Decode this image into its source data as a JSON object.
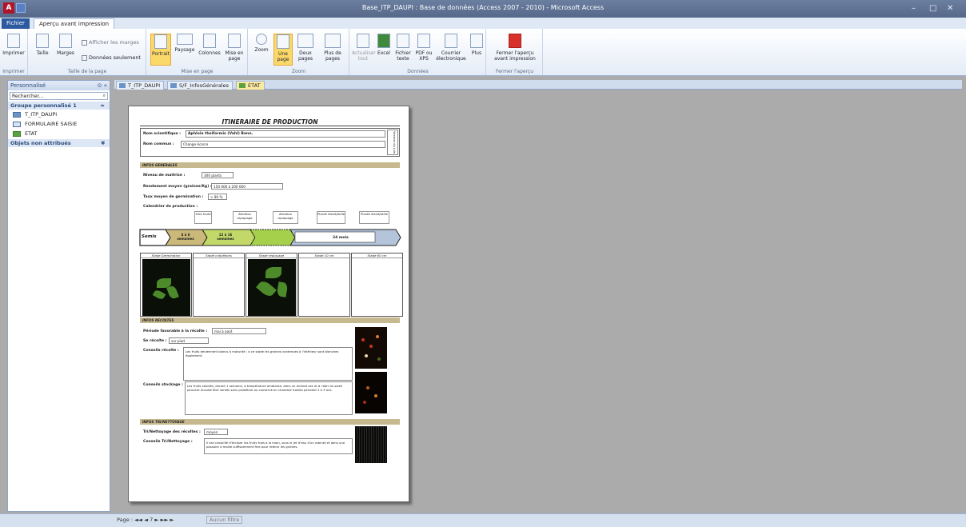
{
  "window": {
    "title": "Base_ITP_DAUPI : Base de données (Access 2007 - 2010) - Microsoft Access",
    "icon": "A",
    "controls": [
      "–",
      "□",
      "✕"
    ]
  },
  "tabs": {
    "file": "Fichier",
    "preview": "Aperçu avant impression"
  },
  "ribbon": {
    "print": {
      "print": "Imprimer",
      "group": "Imprimer"
    },
    "pagesize": {
      "size": "Taille",
      "margins": "Marges",
      "show_margins": "Afficher les marges",
      "data_only": "Données seulement",
      "group": "Taille de la page"
    },
    "layout": {
      "portrait": "Portrait",
      "landscape": "Paysage",
      "columns": "Colonnes",
      "setup": "Mise en page",
      "group": "Mise en page"
    },
    "zoom": {
      "zoom": "Zoom",
      "one": "Une page",
      "two": "Deux pages",
      "more": "Plus de pages",
      "group": "Zoom"
    },
    "data": {
      "refresh": "Actualiser tout",
      "excel": "Excel",
      "text": "Fichier texte",
      "pdf": "PDF ou XPS",
      "email": "Courrier électronique",
      "more": "Plus",
      "group": "Données"
    },
    "close": {
      "close": "Fermer l'aperçu avant impression",
      "group": "Fermer l'aperçu"
    }
  },
  "nav": {
    "header": "Personnalisé",
    "search_placeholder": "Rechercher...",
    "group1": "Groupe personnalisé 1",
    "items": [
      "T_ITP_DAUPI",
      "FORMULAIRE SAISIE",
      "ETAT"
    ],
    "group2": "Objets non attribués"
  },
  "doctabs": [
    "T_ITP_DAUPI",
    "S/F_InfosGénérales",
    "ETAT"
  ],
  "report": {
    "title": "ITINERAIRE DE PRODUCTION",
    "sci_label": "Nom scientifique :",
    "sci_value": "Aphloia theiformis (Vahl) Benn.",
    "common_label": "Nom commun :",
    "common_value": "Change écorce",
    "version": "Version du juin 2012",
    "sec_general": "INFOS GENERALES",
    "level_label": "Niveau de maîtrise :",
    "level_value": "300 plants",
    "yield_label": "Rendement moyen (graines/Kg) :",
    "yield_value": "150 000 à 200 000",
    "germ_label": "Taux moyen de germination :",
    "germ_value": "> 80 %",
    "cal_label": "Calendrier de production :",
    "callouts": [
      "1ère fonte",
      "Aération repiquage",
      "Aération repiquage",
      "Planté élevé/taille",
      "Planté élevé/taille"
    ],
    "arrows": [
      "Semis",
      "4 à 6 semaines",
      "12 à 16 semaines",
      "24 mois"
    ],
    "stages": [
      "Stade Germination",
      "Stade cotylédons",
      "Stade repiquage",
      "Stade 10 cm",
      "Stade 60 cm"
    ],
    "sec_harvest": "INFOS RECOLTES",
    "period_label": "Période favorable à la récolte :",
    "period_value": "mai à août",
    "collect_label": "Se récolte :",
    "collect_value": "sur pied",
    "advice_label": "Conseils récolte :",
    "advice_value": "Les fruits deviennent blancs à maturité ; à ce stade les graines contenues à l'intérieur sont blanches également.",
    "storage_label": "Conseils stockage :",
    "storage_value": "Les fruits stockés, durant 1 semaine, à température ambiante, dans un endroit sec et à l'abri du soleil peuvent ensuite être semés sans problème ou conservé en chambre froides pendant 2 à 3 ans.",
    "sec_sort": "INFOS TRI/NETTOYAGE",
    "sort_label": "Tri/Nettoyage des récoltes :",
    "sort_value": "moyen",
    "sortadv_label": "Conseils Tri/Nettoyage :",
    "sortadv_value": "Il est conseillé d'écraser les fruits frais à la main, sous le jet d'eau d'un robinet et dans une passoire à maille suffisamment fine pour retenir les graines."
  },
  "status": {
    "page": "Page : ◄◄ ◄  7  ► ►► ►",
    "filter": "Aucun filtre"
  }
}
